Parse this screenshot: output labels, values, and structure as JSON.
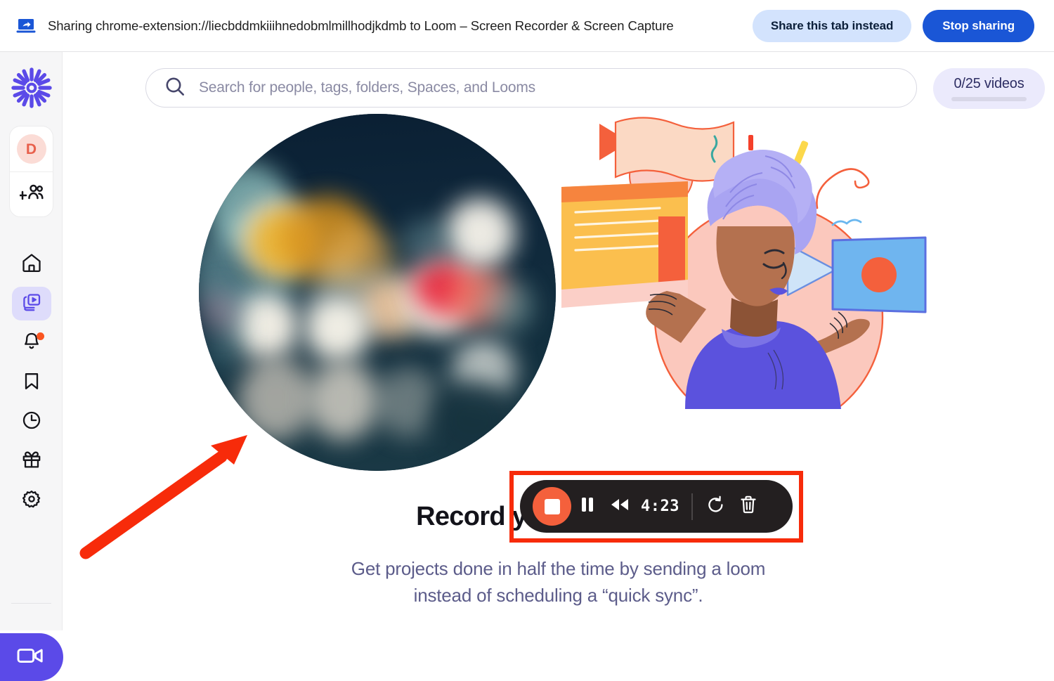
{
  "share_bar": {
    "icon": "screen-share-icon",
    "message": "Sharing chrome-extension://liecbddmkiiihnedobmlmillhodjkdmb to Loom – Screen Recorder & Screen Capture",
    "share_tab_label": "Share this tab instead",
    "stop_sharing_label": "Stop sharing",
    "share_tab_bg": "#d3e3fd",
    "stop_sharing_bg": "#1a56d6"
  },
  "sidebar": {
    "logo": "loom-sunburst-logo",
    "logo_color": "#5b4ae8",
    "avatar": {
      "initial": "D",
      "text_color": "#e8604c",
      "bg_color": "#fbdcd6"
    },
    "add_people_icon": "add-people-icon",
    "items": [
      {
        "name": "home",
        "icon": "home-icon",
        "active": false,
        "badge": false
      },
      {
        "name": "library",
        "icon": "library-icon",
        "active": true,
        "badge": false
      },
      {
        "name": "notifications",
        "icon": "bell-icon",
        "active": false,
        "badge": true
      },
      {
        "name": "bookmarks",
        "icon": "bookmark-icon",
        "active": false,
        "badge": false
      },
      {
        "name": "history",
        "icon": "clock-icon",
        "active": false,
        "badge": false
      },
      {
        "name": "rewards",
        "icon": "gift-icon",
        "active": false,
        "badge": false
      },
      {
        "name": "settings",
        "icon": "gear-icon",
        "active": false,
        "badge": false
      }
    ],
    "record_button": {
      "icon": "video-camera-icon",
      "bg_color": "#5b4ae8"
    },
    "active_bg_color": "#dedcfb",
    "badge_color": "#fa5521"
  },
  "search": {
    "icon": "search-icon",
    "placeholder": "Search for people, tags, folders, Spaces, and Looms",
    "value": ""
  },
  "videos_badge": {
    "label": "0/25 videos",
    "used": 0,
    "total": 25,
    "bg_color": "#ebeafc",
    "text_color": "#2d2d63"
  },
  "hero": {
    "heading": "Record your first Loom",
    "subheading_line1": "Get projects done in half the time by sending a loom",
    "subheading_line2": "instead of scheduling a “quick sync”.",
    "illustration": "record-first-loom-illustration",
    "bokeh_image": "blurred-night-lights-bokeh-circle"
  },
  "recorder_controls": {
    "stop_icon": "stop-recording-icon",
    "pause_icon": "pause-icon",
    "rewind_icon": "rewind-icon",
    "timer": "4:23",
    "restart_icon": "restart-icon",
    "delete_icon": "trash-icon",
    "bar_bg": "#231f20",
    "stop_color": "#f4603c",
    "highlight_color": "#f72b0a"
  },
  "annotation": {
    "arrow": "red-pointer-arrow",
    "color": "#f72b0a",
    "points_at": "recording-area"
  }
}
